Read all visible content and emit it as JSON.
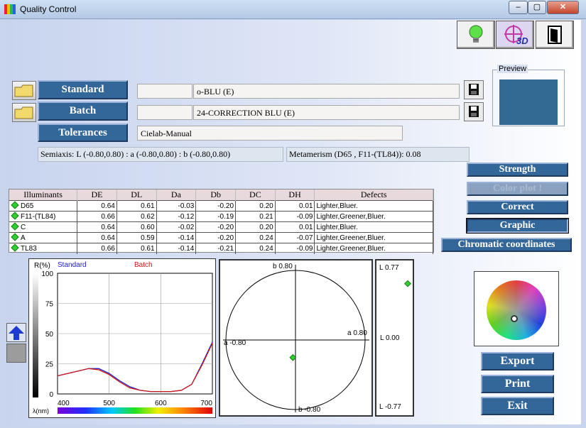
{
  "window": {
    "title": "Quality Control",
    "minimize": "–",
    "maximize": "▢",
    "close": "✕"
  },
  "toolbar": {
    "three_d_label": "3D"
  },
  "form": {
    "standard_label": "Standard",
    "standard_code": "",
    "standard_name": "o-BLU (E)",
    "batch_label": "Batch",
    "batch_code": "",
    "batch_name": "24-CORRECTION BLU (E)",
    "tolerances_label": "Tolerances",
    "tolerances_value": "Cielab-Manual"
  },
  "preview": {
    "label": "Preview",
    "color": "#336a93"
  },
  "info": {
    "semiaxis": "Semiaxis: L (-0.80,0.80)  : a (-0.80,0.80)  : b (-0.80,0.80)",
    "metamerism": "Metamerism  (D65 , F11-(TL84)):   0.08"
  },
  "side_buttons": {
    "strength": "Strength",
    "color_plot": "Color plot !",
    "correct": "Correct",
    "graphic": "Graphic",
    "chromatic": "Chromatic coordinates"
  },
  "table": {
    "headers": [
      "Illuminants",
      "DE",
      "DL",
      "Da",
      "Db",
      "DC",
      "DH",
      "Defects"
    ],
    "rows": [
      [
        "D65",
        "0.64",
        "0.61",
        "-0.03",
        "-0.20",
        "0.20",
        "0.01",
        "Lighter,Bluer."
      ],
      [
        "F11-(TL84)",
        "0.66",
        "0.62",
        "-0.12",
        "-0.19",
        "0.21",
        "-0.09",
        "Lighter,Greener,Bluer."
      ],
      [
        "C",
        "0.64",
        "0.60",
        "-0.02",
        "-0.20",
        "0.20",
        "0.01",
        "Lighter,Bluer."
      ],
      [
        "A",
        "0.64",
        "0.59",
        "-0.14",
        "-0.20",
        "0.24",
        "-0.07",
        "Lighter,Greener,Bluer."
      ],
      [
        "TL83",
        "0.66",
        "0.61",
        "-0.14",
        "-0.21",
        "0.24",
        "-0.09",
        "Lighter,Greener,Bluer."
      ]
    ]
  },
  "spectrum": {
    "y_label": "R(%)",
    "x_label": "λ(nm)",
    "standard_legend": "Standard",
    "batch_legend": "Batch",
    "y_ticks": [
      "100",
      "75",
      "50",
      "25",
      "0"
    ],
    "x_ticks": [
      "400",
      "500",
      "600",
      "700"
    ],
    "standard_color": "#2020c8",
    "batch_color": "#d01818"
  },
  "chart_data": {
    "type": "line",
    "xlabel": "λ(nm)",
    "ylabel": "R(%)",
    "xlim": [
      400,
      700
    ],
    "ylim": [
      0,
      100
    ],
    "x": [
      400,
      420,
      440,
      460,
      480,
      500,
      520,
      540,
      560,
      580,
      600,
      620,
      640,
      660,
      680,
      700
    ],
    "series": [
      {
        "name": "Standard",
        "values": [
          15,
          17,
          19,
          21,
          21,
          17,
          11,
          6,
          3,
          2,
          2,
          2,
          3,
          8,
          25,
          43
        ]
      },
      {
        "name": "Batch",
        "values": [
          15,
          17,
          19,
          21,
          20,
          16,
          10,
          5,
          3,
          2,
          2,
          2,
          3,
          8,
          24,
          42
        ]
      }
    ]
  },
  "ab_plot": {
    "b_pos": "b 0.80",
    "b_neg": "b -0.80",
    "a_pos": "a 0.80",
    "a_neg": "a -0.80",
    "da": -0.03,
    "db": -0.2
  },
  "l_plot": {
    "top": "L 0.77",
    "mid": "L 0.00",
    "bottom": "L -0.77",
    "dl": 0.61
  },
  "actions": {
    "export": "Export",
    "print": "Print",
    "exit": "Exit"
  }
}
